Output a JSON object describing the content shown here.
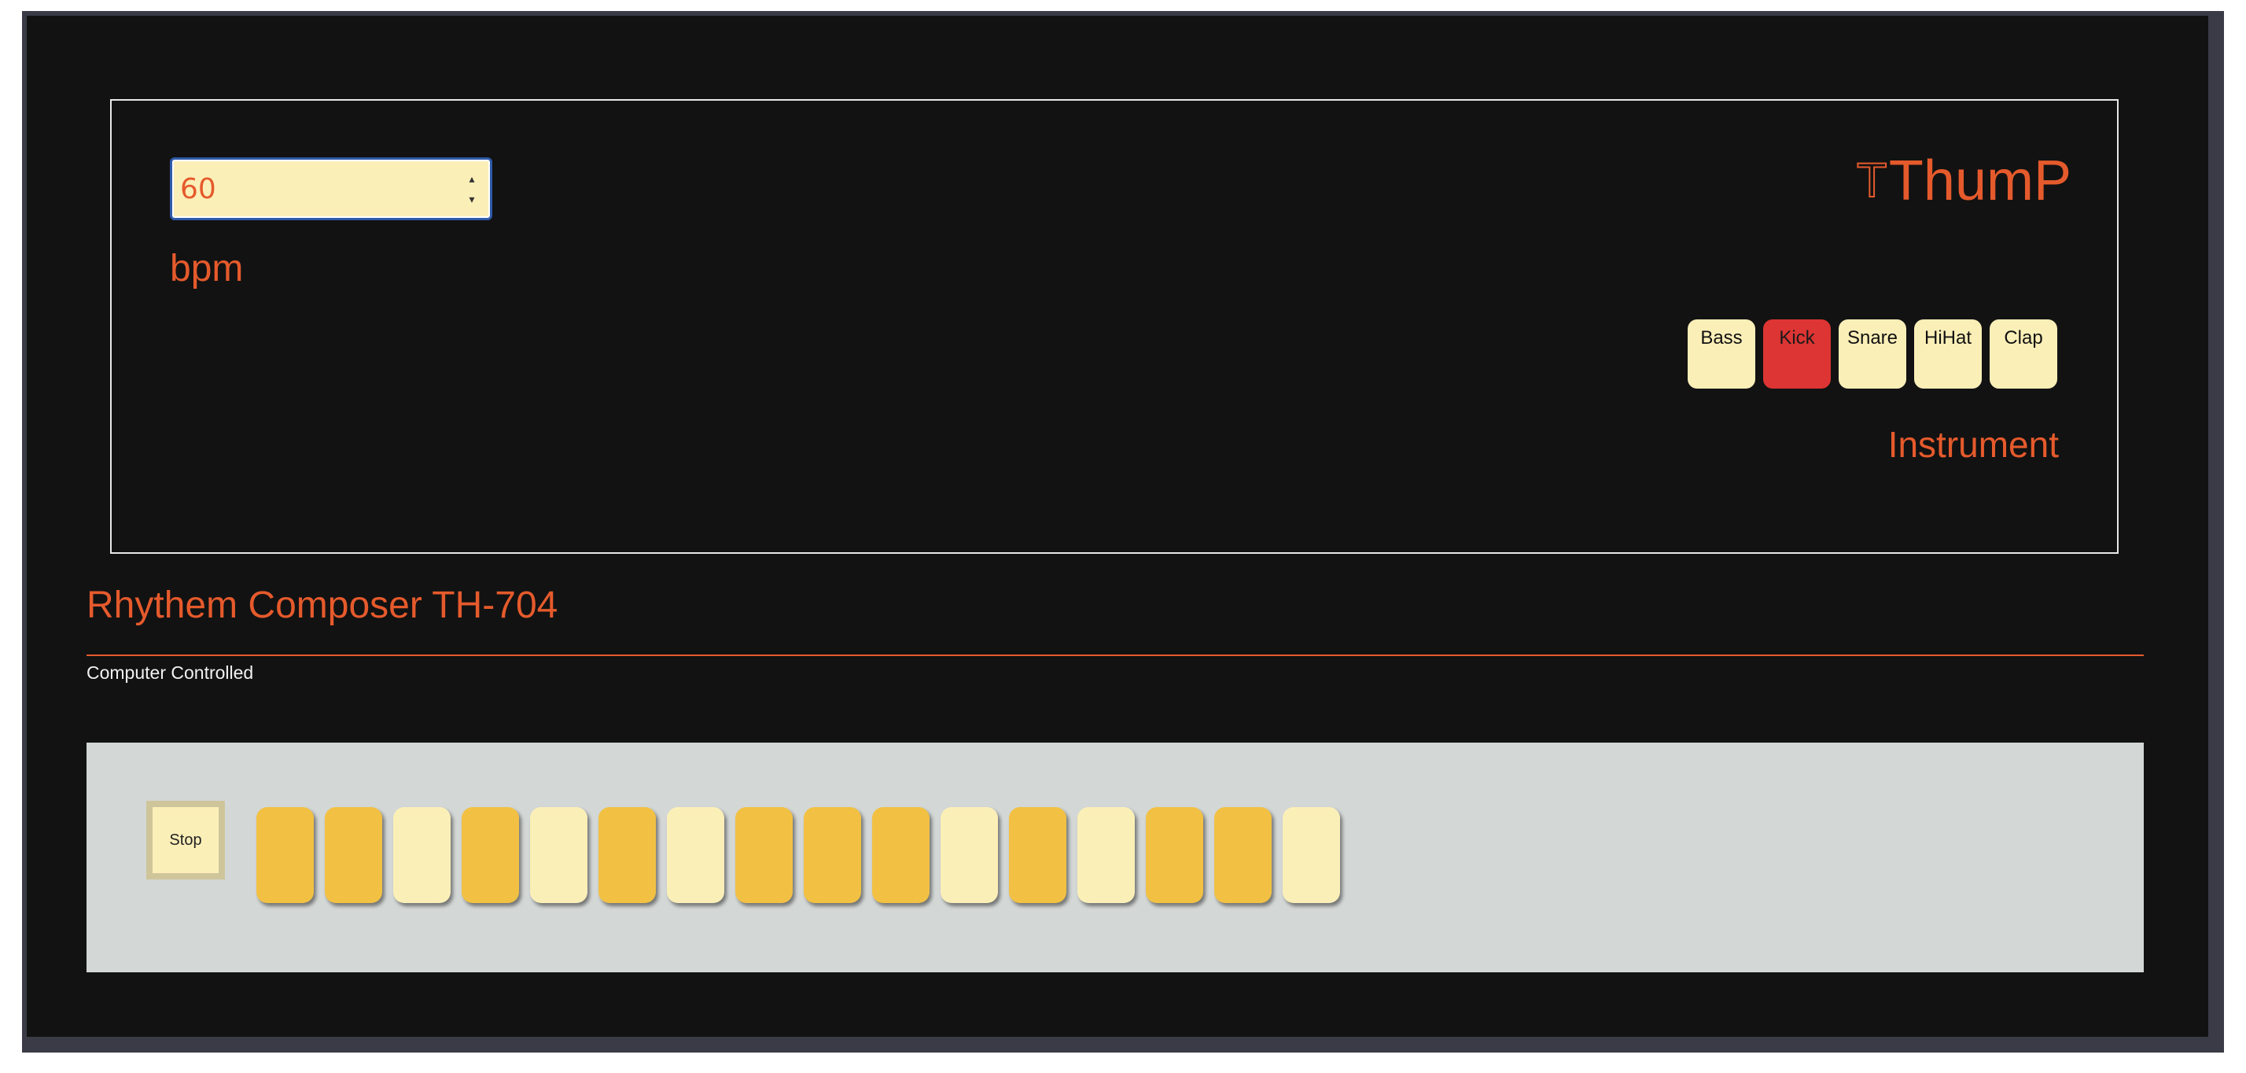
{
  "controls": {
    "bpm_value": "60",
    "bpm_label": "bpm"
  },
  "brand": {
    "icon": "T-outline-logo",
    "icon_glyph": "T",
    "name": "ThumP"
  },
  "instruments": {
    "items": [
      {
        "label": "Bass",
        "active": false
      },
      {
        "label": "Kick",
        "active": true
      },
      {
        "label": "Snare",
        "active": false
      },
      {
        "label": "HiHat",
        "active": false
      },
      {
        "label": "Clap",
        "active": false
      }
    ],
    "label": "Instrument"
  },
  "header": {
    "title": "Rhythem Composer TH-704",
    "subtitle": "Computer Controlled"
  },
  "sequencer": {
    "stop_label": "Stop",
    "steps": [
      true,
      true,
      false,
      true,
      false,
      true,
      false,
      true,
      true,
      true,
      false,
      true,
      false,
      true,
      true,
      false
    ]
  },
  "colors": {
    "accent": "#e55a2c",
    "active_instrument": "#dc3533",
    "step_on": "#f2c144",
    "step_off": "#fbefb8",
    "background": "#121212"
  }
}
